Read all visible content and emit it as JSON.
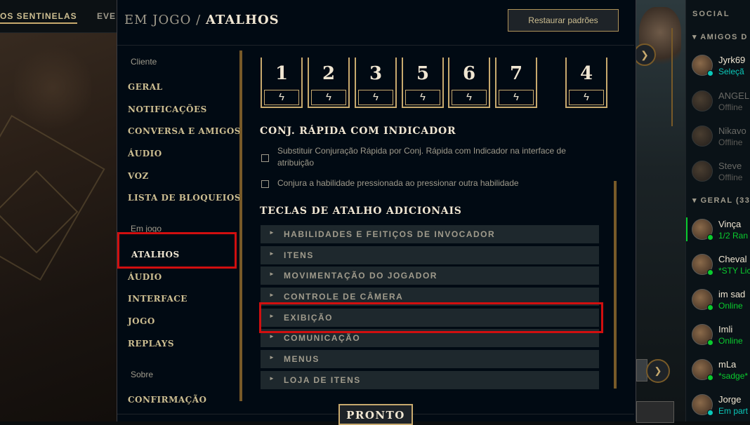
{
  "background": {
    "topnav": [
      "OS SENTINELAS",
      "EVE"
    ]
  },
  "modal": {
    "breadcrumb_section": "EM JOGO",
    "breadcrumb_sep": "/",
    "breadcrumb_page": "ATALHOS",
    "restore_label": "Restaurar padrões",
    "done_label": "PRONTO"
  },
  "nav": {
    "group_client": "Cliente",
    "client_items": [
      "GERAL",
      "NOTIFICAÇÕES",
      "CONVERSA E AMIGOS",
      "ÁUDIO",
      "VOZ",
      "LISTA DE BLOQUEIOS"
    ],
    "group_ingame": "Em jogo",
    "ingame_items": [
      "ATALHOS",
      "ÁUDIO",
      "INTERFACE",
      "JOGO",
      "REPLAYS"
    ],
    "group_about": "Sobre",
    "about_items": [
      "CONFIRMAÇÃO"
    ]
  },
  "keys": [
    "1",
    "2",
    "3",
    "5",
    "6",
    "7",
    "4"
  ],
  "quickcast": {
    "title": "CONJ. RÁPIDA COM INDICADOR",
    "options": [
      {
        "label": "Substituir Conjuração Rápida por Conj. Rápida com Indicador na interface de atribuição",
        "checked": false
      },
      {
        "label": "Conjura a habilidade pressionada ao pressionar outra habilidade",
        "checked": false
      }
    ]
  },
  "additional": {
    "title": "TECLAS DE ATALHO ADICIONAIS",
    "categories": [
      "HABILIDADES E FEITIÇOS DE INVOCADOR",
      "ITENS",
      "MOVIMENTAÇÃO DO JOGADOR",
      "CONTROLE DE CÂMERA",
      "EXIBIÇÃO",
      "COMUNICAÇÃO",
      "MENUS",
      "LOJA DE ITENS"
    ]
  },
  "social": {
    "title": "SOCIAL",
    "group1": "AMIGOS D",
    "group2": "GERAL (33",
    "friends": [
      {
        "name": "Jyrk69",
        "status": "Seleçã",
        "online": true,
        "status_color": "#0ac8b9"
      },
      {
        "name": "ANGEL",
        "status": "Offline",
        "online": false
      },
      {
        "name": "Nikavo",
        "status": "Offline",
        "online": false
      },
      {
        "name": "Steve",
        "status": "Offline",
        "online": false
      },
      {
        "name": "Vinça",
        "status": "1/2 Ran",
        "online": true,
        "status_color": "#0acb2e"
      },
      {
        "name": "Cheval",
        "status": "*STY Lic",
        "online": true,
        "status_color": "#0acb2e"
      },
      {
        "name": "im sad",
        "status": "Online",
        "online": true,
        "status_color": "#0acb2e"
      },
      {
        "name": "Imli",
        "status": "Online",
        "online": true,
        "status_color": "#0acb2e"
      },
      {
        "name": "mLa",
        "status": "*sadge*",
        "online": true,
        "status_color": "#0acb2e"
      },
      {
        "name": "Jorge",
        "status": "Em part",
        "online": true,
        "status_color": "#0ac8b9"
      }
    ]
  },
  "colors": {
    "gold": "#c8aa6e",
    "highlight": "#d10f0f",
    "panel_bg": "#010a13"
  }
}
